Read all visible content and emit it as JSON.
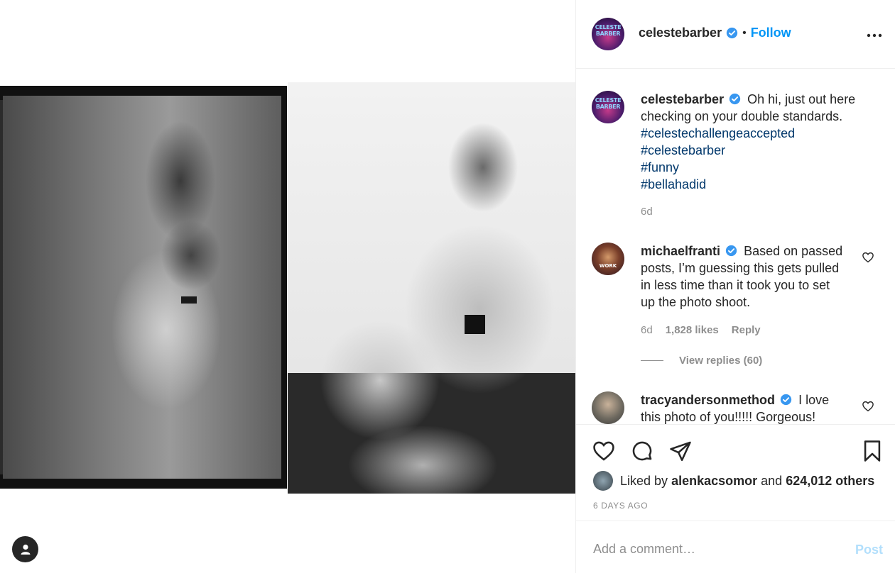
{
  "post": {
    "author": "celestebarber",
    "follow_label": "Follow",
    "separator": "•",
    "avatar_text": "CELESTE BARBER",
    "caption": {
      "text": "Oh hi, just out here checking on your double standards.",
      "hashtags": [
        "#celestechallengeaccepted",
        "#celestebarber",
        "#funny",
        "#bellahadid"
      ],
      "age": "6d"
    }
  },
  "comments": [
    {
      "username": "michaelfranti",
      "text": "Based on passed posts, I’m guessing this gets pulled in less time than it took you to set up the photo shoot.",
      "age": "6d",
      "likes": "1,828 likes",
      "reply_label": "Reply",
      "view_replies": "View replies (60)",
      "avatar_text": "WORK"
    },
    {
      "username": "tracyandersonmethod",
      "text": "I love this photo of you!!!!! Gorgeous!"
    }
  ],
  "likes": {
    "prefix": "Liked by",
    "user": "alenkacsomor",
    "conj": "and",
    "others": "624,012 others"
  },
  "date": "6 DAYS AGO",
  "comment_input": {
    "placeholder": "Add a comment…",
    "post_label": "Post"
  },
  "colors": {
    "accent": "#0095f6",
    "hashtag": "#00376b",
    "muted": "#8e8e8e",
    "post_disabled": "#b2dffc"
  },
  "icons": [
    "verified-icon",
    "more-icon",
    "heart-icon",
    "comment-icon",
    "share-icon",
    "bookmark-icon",
    "account-icon"
  ]
}
